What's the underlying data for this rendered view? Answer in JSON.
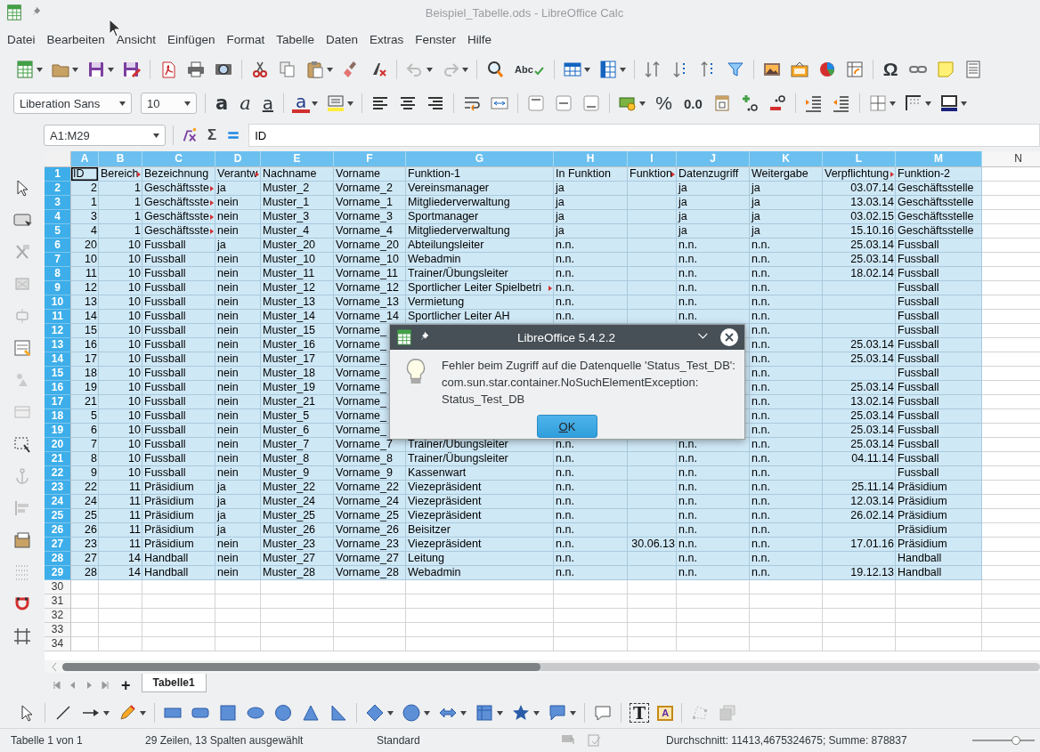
{
  "window": {
    "title": "Beispiel_Tabelle.ods - LibreOffice Calc"
  },
  "menu": [
    "Datei",
    "Bearbeiten",
    "Ansicht",
    "Einfügen",
    "Format",
    "Tabelle",
    "Daten",
    "Extras",
    "Fenster",
    "Hilfe"
  ],
  "standard_toolbar": {
    "spelling_label": "Abc",
    "special_character": "Ω"
  },
  "formatting_toolbar": {
    "font_name": "Liberation Sans",
    "font_size": "10",
    "bold": "a",
    "italic": "a",
    "underline": "a",
    "font_color": "a",
    "percent": "%",
    "decimal_format": "0.0"
  },
  "formula_bar": {
    "cell_reference": "A1:M29",
    "sum": "Σ",
    "content": "ID"
  },
  "sheet": {
    "columns": [
      {
        "label": "A",
        "selected": true,
        "kind": "number"
      },
      {
        "label": "B",
        "selected": true,
        "kind": "number"
      },
      {
        "label": "C",
        "selected": true,
        "kind": "text"
      },
      {
        "label": "D",
        "selected": true,
        "kind": "text"
      },
      {
        "label": "E",
        "selected": true,
        "kind": "text"
      },
      {
        "label": "F",
        "selected": true,
        "kind": "text"
      },
      {
        "label": "G",
        "selected": true,
        "kind": "text"
      },
      {
        "label": "H",
        "selected": true,
        "kind": "text"
      },
      {
        "label": "I",
        "selected": true,
        "kind": "number"
      },
      {
        "label": "J",
        "selected": true,
        "kind": "text"
      },
      {
        "label": "K",
        "selected": true,
        "kind": "text"
      },
      {
        "label": "L",
        "selected": true,
        "kind": "number"
      },
      {
        "label": "M",
        "selected": true,
        "kind": "text"
      },
      {
        "label": "N",
        "selected": false
      }
    ],
    "rows": [
      {
        "label": "1",
        "selected": true,
        "kind": "header",
        "cells": [
          {
            "text": "ID",
            "active": true
          },
          {
            "text": "Bereich",
            "clipped": true
          },
          "Bezeichnung",
          {
            "text": "Verantw",
            "clipped": true
          },
          "Nachname",
          "Vorname",
          "Funktion-1",
          "In Funktion",
          {
            "text": "Funktion",
            "clipped": true
          },
          "Datenzugriff",
          "Weitergabe",
          {
            "text": "Verpflichtung",
            "clipped": true
          },
          "Funktion-2"
        ]
      },
      {
        "label": "2",
        "selected": true,
        "kind": "data",
        "cells": [
          "2",
          "1",
          {
            "text": "Geschäftsste",
            "clipped": true
          },
          "ja",
          "Muster_2",
          "Vorname_2",
          "Vereinsmanager",
          "ja",
          null,
          "ja",
          "ja",
          "03.07.14",
          "Geschäftsstelle"
        ]
      },
      {
        "label": "3",
        "selected": true,
        "kind": "data",
        "cells": [
          "1",
          "1",
          {
            "text": "Geschäftsste",
            "clipped": true
          },
          "nein",
          "Muster_1",
          "Vorname_1",
          "Mitgliederverwaltung",
          "ja",
          null,
          "ja",
          "ja",
          "13.03.14",
          "Geschäftsstelle"
        ]
      },
      {
        "label": "4",
        "selected": true,
        "kind": "data",
        "cells": [
          "3",
          "1",
          {
            "text": "Geschäftsste",
            "clipped": true
          },
          "nein",
          "Muster_3",
          "Vorname_3",
          "Sportmanager",
          "ja",
          null,
          "ja",
          "ja",
          "03.02.15",
          "Geschäftsstelle"
        ]
      },
      {
        "label": "5",
        "selected": true,
        "kind": "data",
        "cells": [
          "4",
          "1",
          {
            "text": "Geschäftsste",
            "clipped": true
          },
          "nein",
          "Muster_4",
          "Vorname_4",
          "Mitgliederverwaltung",
          "ja",
          null,
          "ja",
          "ja",
          "15.10.16",
          "Geschäftsstelle"
        ]
      },
      {
        "label": "6",
        "selected": true,
        "kind": "data",
        "cells": [
          "20",
          "10",
          "Fussball",
          "ja",
          "Muster_20",
          "Vorname_20",
          "Abteilungsleiter",
          "n.n.",
          null,
          "n.n.",
          "n.n.",
          "25.03.14",
          "Fussball"
        ]
      },
      {
        "label": "7",
        "selected": true,
        "kind": "data",
        "cells": [
          "10",
          "10",
          "Fussball",
          "nein",
          "Muster_10",
          "Vorname_10",
          "Webadmin",
          "n.n.",
          null,
          "n.n.",
          "n.n.",
          "25.03.14",
          "Fussball"
        ]
      },
      {
        "label": "8",
        "selected": true,
        "kind": "data",
        "cells": [
          "11",
          "10",
          "Fussball",
          "nein",
          "Muster_11",
          "Vorname_11",
          "Trainer/Übungsleiter",
          "n.n.",
          null,
          "n.n.",
          "n.n.",
          "18.02.14",
          "Fussball"
        ]
      },
      {
        "label": "9",
        "selected": true,
        "kind": "data",
        "cells": [
          "12",
          "10",
          "Fussball",
          "nein",
          "Muster_12",
          "Vorname_12",
          {
            "text": "Sportlicher Leiter Spielbetri",
            "clipped": true
          },
          "n.n.",
          null,
          "n.n.",
          "n.n.",
          null,
          "Fussball"
        ]
      },
      {
        "label": "10",
        "selected": true,
        "kind": "data",
        "cells": [
          "13",
          "10",
          "Fussball",
          "nein",
          "Muster_13",
          "Vorname_13",
          "Vermietung",
          "n.n.",
          null,
          "n.n.",
          "n.n.",
          null,
          "Fussball"
        ]
      },
      {
        "label": "11",
        "selected": true,
        "kind": "data",
        "cells": [
          "14",
          "10",
          "Fussball",
          "nein",
          "Muster_14",
          "Vorname_14",
          "Sportlicher Leiter AH",
          "n.n.",
          null,
          "n.n.",
          "n.n.",
          null,
          "Fussball"
        ]
      },
      {
        "label": "12",
        "selected": true,
        "kind": "data",
        "cells": [
          "15",
          "10",
          "Fussball",
          "nein",
          "Muster_15",
          "Vorname_",
          null,
          null,
          null,
          null,
          "n.n.",
          null,
          "Fussball"
        ]
      },
      {
        "label": "13",
        "selected": true,
        "kind": "data",
        "cells": [
          "16",
          "10",
          "Fussball",
          "nein",
          "Muster_16",
          "Vorname_",
          null,
          null,
          null,
          null,
          "n.n.",
          "25.03.14",
          "Fussball"
        ]
      },
      {
        "label": "14",
        "selected": true,
        "kind": "data",
        "cells": [
          "17",
          "10",
          "Fussball",
          "nein",
          "Muster_17",
          "Vorname_",
          null,
          null,
          null,
          null,
          "n.n.",
          "25.03.14",
          "Fussball"
        ]
      },
      {
        "label": "15",
        "selected": true,
        "kind": "data",
        "cells": [
          "18",
          "10",
          "Fussball",
          "nein",
          "Muster_18",
          "Vorname_",
          null,
          null,
          null,
          null,
          "n.n.",
          null,
          "Fussball"
        ]
      },
      {
        "label": "16",
        "selected": true,
        "kind": "data",
        "cells": [
          "19",
          "10",
          "Fussball",
          "nein",
          "Muster_19",
          "Vorname_",
          null,
          null,
          null,
          null,
          "n.n.",
          "25.03.14",
          "Fussball"
        ]
      },
      {
        "label": "17",
        "selected": true,
        "kind": "data",
        "cells": [
          "21",
          "10",
          "Fussball",
          "nein",
          "Muster_21",
          "Vorname_",
          null,
          null,
          null,
          null,
          "n.n.",
          "13.02.14",
          "Fussball"
        ]
      },
      {
        "label": "18",
        "selected": true,
        "kind": "data",
        "cells": [
          "5",
          "10",
          "Fussball",
          "nein",
          "Muster_5",
          "Vorname_",
          null,
          null,
          null,
          null,
          "n.n.",
          "25.03.14",
          "Fussball"
        ]
      },
      {
        "label": "19",
        "selected": true,
        "kind": "data",
        "cells": [
          "6",
          "10",
          "Fussball",
          "nein",
          "Muster_6",
          "Vorname_",
          null,
          null,
          null,
          null,
          "n.n.",
          "25.03.14",
          "Fussball"
        ]
      },
      {
        "label": "20",
        "selected": true,
        "kind": "data",
        "cells": [
          "7",
          "10",
          "Fussball",
          "nein",
          "Muster_7",
          "Vorname_7",
          "Trainer/Übungsleiter",
          "n.n.",
          null,
          "n.n.",
          "n.n.",
          "25.03.14",
          "Fussball"
        ]
      },
      {
        "label": "21",
        "selected": true,
        "kind": "data",
        "cells": [
          "8",
          "10",
          "Fussball",
          "nein",
          "Muster_8",
          "Vorname_8",
          "Trainer/Übungsleiter",
          "n.n.",
          null,
          "n.n.",
          "n.n.",
          "04.11.14",
          "Fussball"
        ]
      },
      {
        "label": "22",
        "selected": true,
        "kind": "data",
        "cells": [
          "9",
          "10",
          "Fussball",
          "nein",
          "Muster_9",
          "Vorname_9",
          "Kassenwart",
          "n.n.",
          null,
          "n.n.",
          "n.n.",
          null,
          "Fussball"
        ]
      },
      {
        "label": "23",
        "selected": true,
        "kind": "data",
        "cells": [
          "22",
          "11",
          "Präsidium",
          "ja",
          "Muster_22",
          "Vorname_22",
          "Viezepräsident",
          "n.n.",
          null,
          "n.n.",
          "n.n.",
          "25.11.14",
          "Präsidium"
        ]
      },
      {
        "label": "24",
        "selected": true,
        "kind": "data",
        "cells": [
          "24",
          "11",
          "Präsidium",
          "ja",
          "Muster_24",
          "Vorname_24",
          "Viezepräsident",
          "n.n.",
          null,
          "n.n.",
          "n.n.",
          "12.03.14",
          "Präsidium"
        ]
      },
      {
        "label": "25",
        "selected": true,
        "kind": "data",
        "cells": [
          "25",
          "11",
          "Präsidium",
          "ja",
          "Muster_25",
          "Vorname_25",
          "Viezepräsident",
          "n.n.",
          null,
          "n.n.",
          "n.n.",
          "26.02.14",
          "Präsidium"
        ]
      },
      {
        "label": "26",
        "selected": true,
        "kind": "data",
        "cells": [
          "26",
          "11",
          "Präsidium",
          "ja",
          "Muster_26",
          "Vorname_26",
          "Beisitzer",
          "n.n.",
          null,
          "n.n.",
          "n.n.",
          null,
          "Präsidium"
        ]
      },
      {
        "label": "27",
        "selected": true,
        "kind": "data",
        "cells": [
          "23",
          "11",
          "Präsidium",
          "nein",
          "Muster_23",
          "Vorname_23",
          "Viezepräsident",
          "n.n.",
          "30.06.13",
          "n.n.",
          "n.n.",
          "17.01.16",
          "Präsidium"
        ]
      },
      {
        "label": "28",
        "selected": true,
        "kind": "data",
        "cells": [
          "27",
          "14",
          "Handball",
          "nein",
          "Muster_27",
          "Vorname_27",
          "Leitung",
          "n.n.",
          null,
          "n.n.",
          "n.n.",
          null,
          "Handball"
        ]
      },
      {
        "label": "29",
        "selected": true,
        "kind": "data",
        "cells": [
          "28",
          "14",
          "Handball",
          "nein",
          "Muster_28",
          "Vorname_28",
          "Webadmin",
          "n.n.",
          null,
          "n.n.",
          "n.n.",
          "19.12.13",
          "Handball"
        ]
      },
      {
        "label": "30",
        "selected": false
      },
      {
        "label": "31",
        "selected": false
      },
      {
        "label": "32",
        "selected": false
      },
      {
        "label": "33",
        "selected": false
      },
      {
        "label": "34",
        "selected": false
      }
    ]
  },
  "dialog": {
    "title": "LibreOffice 5.4.2.2",
    "message": "Fehler beim Zugriff auf die Datenquelle 'Status_Test_DB':\ncom.sun.star.container.NoSuchElementException:\nStatus_Test_DB",
    "button": "OK"
  },
  "sheet_tabs": {
    "add": "+",
    "tabs": [
      {
        "label": "Tabelle1",
        "selected": true
      }
    ]
  },
  "drawing_toolbar": {
    "text_box": "T",
    "fontwork": "A"
  },
  "status_bar": {
    "sheet": "Tabelle 1 von 1",
    "selection": "29 Zeilen, 13 Spalten ausgewählt",
    "page_style": "Standard",
    "statistics": "Durchschnitt: 11413,4675324675; Summe: 878837",
    "zoom": {
      "level": 0.7
    }
  }
}
